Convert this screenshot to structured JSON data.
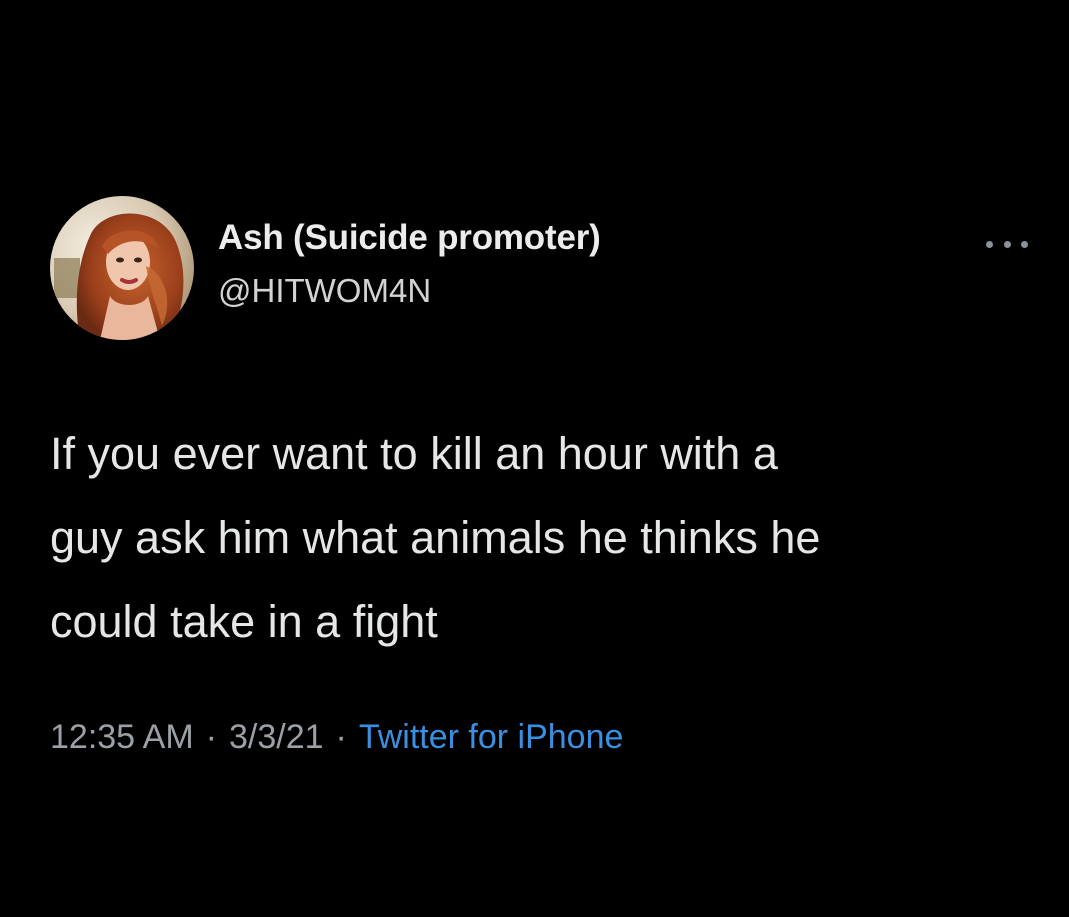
{
  "tweet": {
    "display_name": "Ash (Suicide promoter)",
    "handle": "@HITWOM4N",
    "more_icon": "more-horizontal-icon",
    "text_lines": [
      "If you ever want to kill an hour with a",
      "guy ask him what animals he thinks he",
      "could take in a fight"
    ],
    "time": "12:35 AM",
    "date": "3/3/21",
    "separator": "·",
    "source": "Twitter for iPhone"
  },
  "colors": {
    "background": "#000000",
    "text": "#e4e6e7",
    "secondary_text": "#9aa0a6",
    "link": "#3a8fe0"
  }
}
